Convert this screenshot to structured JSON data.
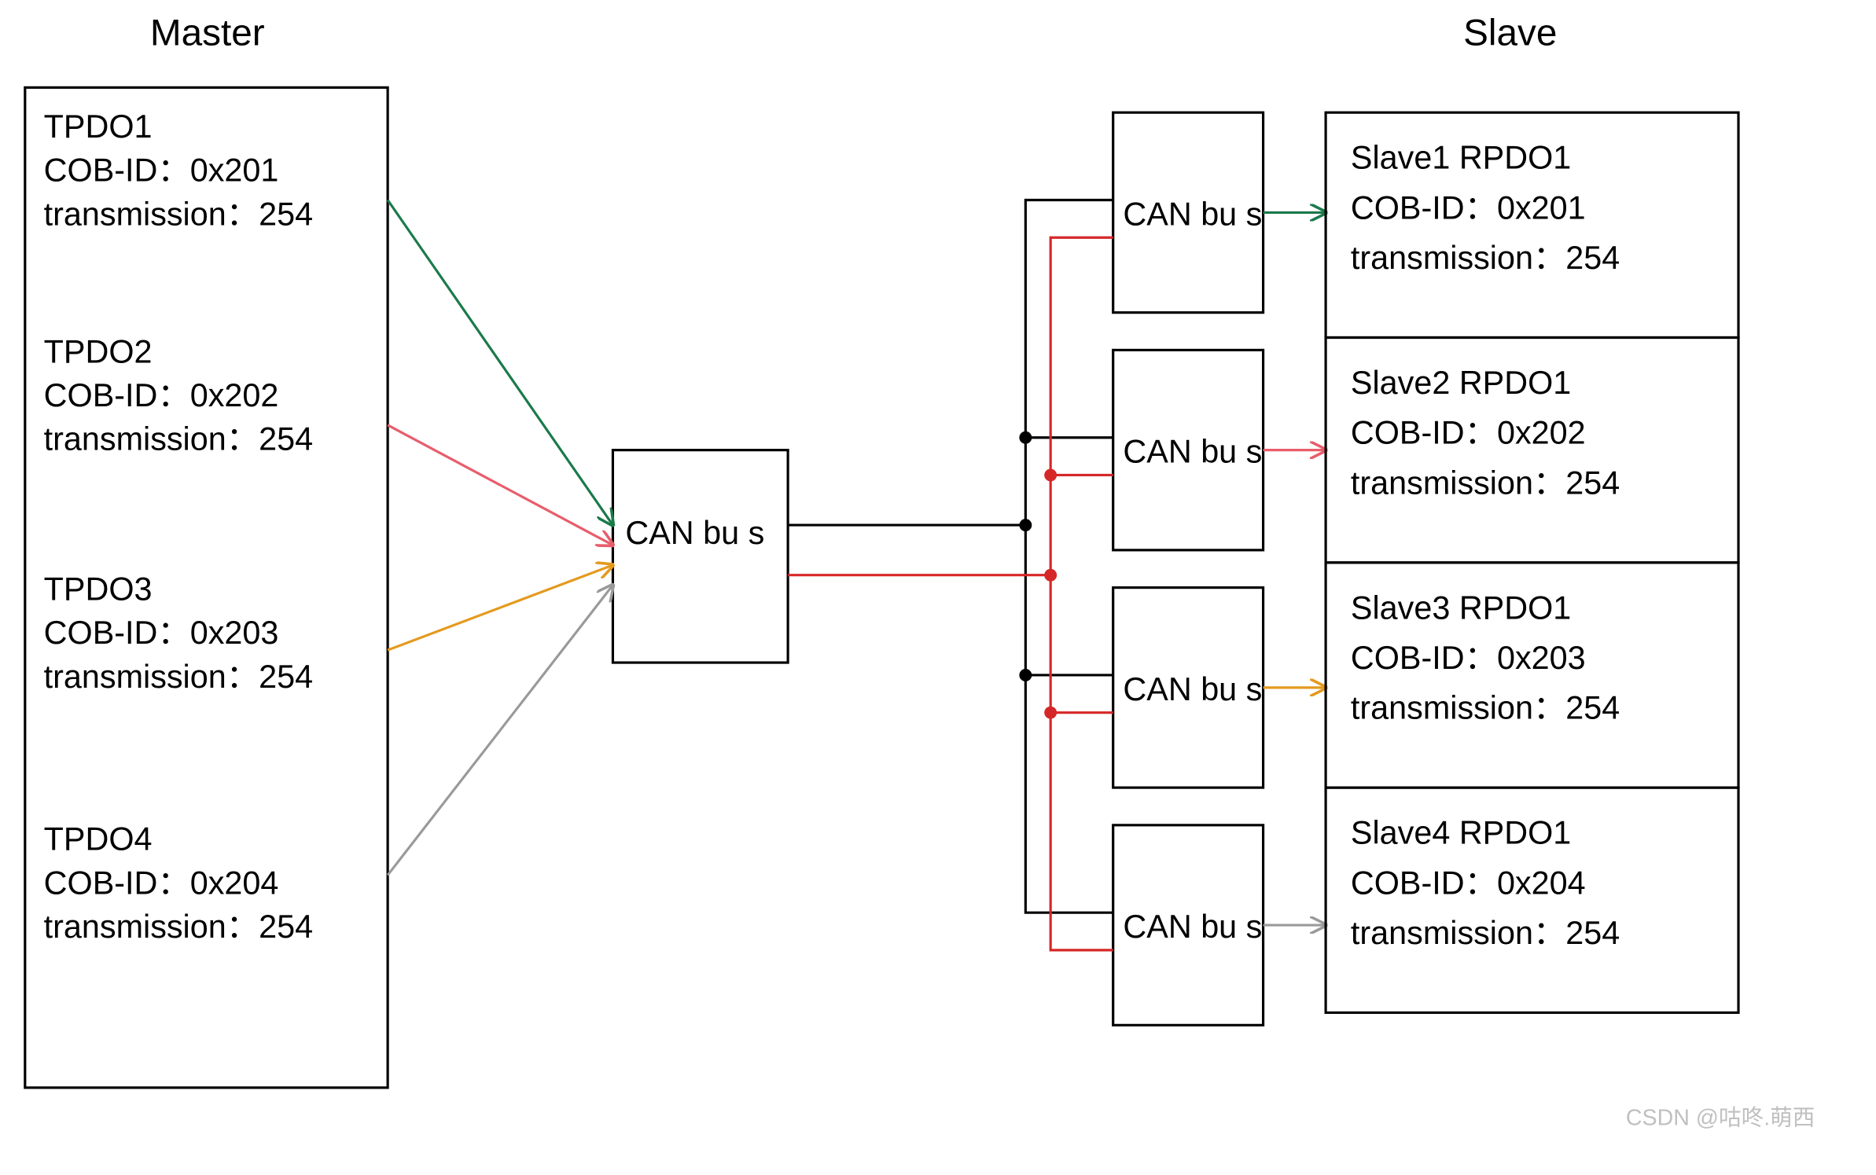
{
  "titles": {
    "master": "Master",
    "slave": "Slave"
  },
  "master": {
    "tpdo": [
      {
        "name": "TPDO1",
        "cob": "COB-ID：0x201",
        "trans": "transmission：254"
      },
      {
        "name": "TPDO2",
        "cob": "COB-ID：0x202",
        "trans": "transmission：254"
      },
      {
        "name": "TPDO3",
        "cob": "COB-ID：0x203",
        "trans": "transmission：254"
      },
      {
        "name": "TPDO4",
        "cob": "COB-ID：0x204",
        "trans": "transmission：254"
      }
    ]
  },
  "center_bus": "CAN bu s",
  "relay_bus": [
    "CAN bu s",
    "CAN bu s",
    "CAN bu s",
    "CAN bu s"
  ],
  "slaves": [
    {
      "name": "Slave1 RPDO1",
      "cob": "COB-ID：0x201",
      "trans": "transmission：254"
    },
    {
      "name": "Slave2 RPDO1",
      "cob": "COB-ID：0x202",
      "trans": "transmission：254"
    },
    {
      "name": "Slave3 RPDO1",
      "cob": "COB-ID：0x203",
      "trans": "transmission：254"
    },
    {
      "name": "Slave4 RPDO1",
      "cob": "COB-ID：0x204",
      "trans": "transmission：254"
    }
  ],
  "colors": {
    "tpdo1": "#1a7a4a",
    "tpdo2": "#e85d6b",
    "tpdo3": "#e49a1f",
    "tpdo4": "#9a9a9a",
    "black": "#000000",
    "red": "#d62728"
  },
  "watermark": "CSDN @咕咚.萌西"
}
